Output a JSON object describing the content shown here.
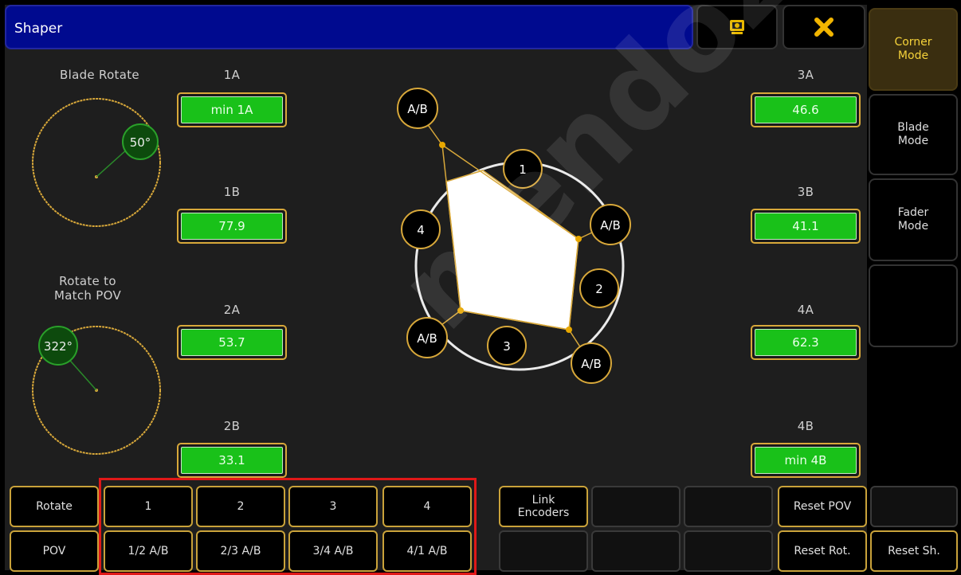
{
  "title": "Shaper",
  "icons": {
    "screenshot": "screen-icon",
    "close": "close-icon"
  },
  "colors": {
    "title_bg": "#000a8f",
    "value_green": "#19c119",
    "gold": "#d8a83a",
    "active_text": "#f5d23a",
    "highlight": "#e01818"
  },
  "left": {
    "blade_rotate_label": "Blade Rotate",
    "blade_rotate_value": "50°",
    "rotate_pov_label": "Rotate to\nMatch POV",
    "rotate_pov_value": "322°"
  },
  "values": {
    "a1_label": "1A",
    "a1_value": "min 1A",
    "b1_label": "1B",
    "b1_value": "77.9",
    "a2_label": "2A",
    "a2_value": "53.7",
    "b2_label": "2B",
    "b2_value": "33.1",
    "a3_label": "3A",
    "a3_value": "46.6",
    "b3_label": "3B",
    "b3_value": "41.1",
    "a4_label": "4A",
    "a4_value": "62.3",
    "b4_label": "4B",
    "b4_value": "min 4B"
  },
  "shape": {
    "blade_labels": [
      "1",
      "2",
      "3",
      "4"
    ],
    "corner_label": "A/B"
  },
  "side_modes": [
    "Corner\nMode",
    "Blade\nMode",
    "Fader\nMode",
    ""
  ],
  "bottom": {
    "rotate": "Rotate",
    "pov": "POV",
    "blades": [
      "1",
      "2",
      "3",
      "4"
    ],
    "corners": [
      "1/2 A/B",
      "2/3 A/B",
      "3/4 A/B",
      "4/1 A/B"
    ],
    "link_encoders": "Link\nEncoders",
    "reset_pov": "Reset POV",
    "reset_rot": "Reset Rot.",
    "reset_sh": "Reset Sh."
  },
  "watermark": "mendoza.com.r"
}
